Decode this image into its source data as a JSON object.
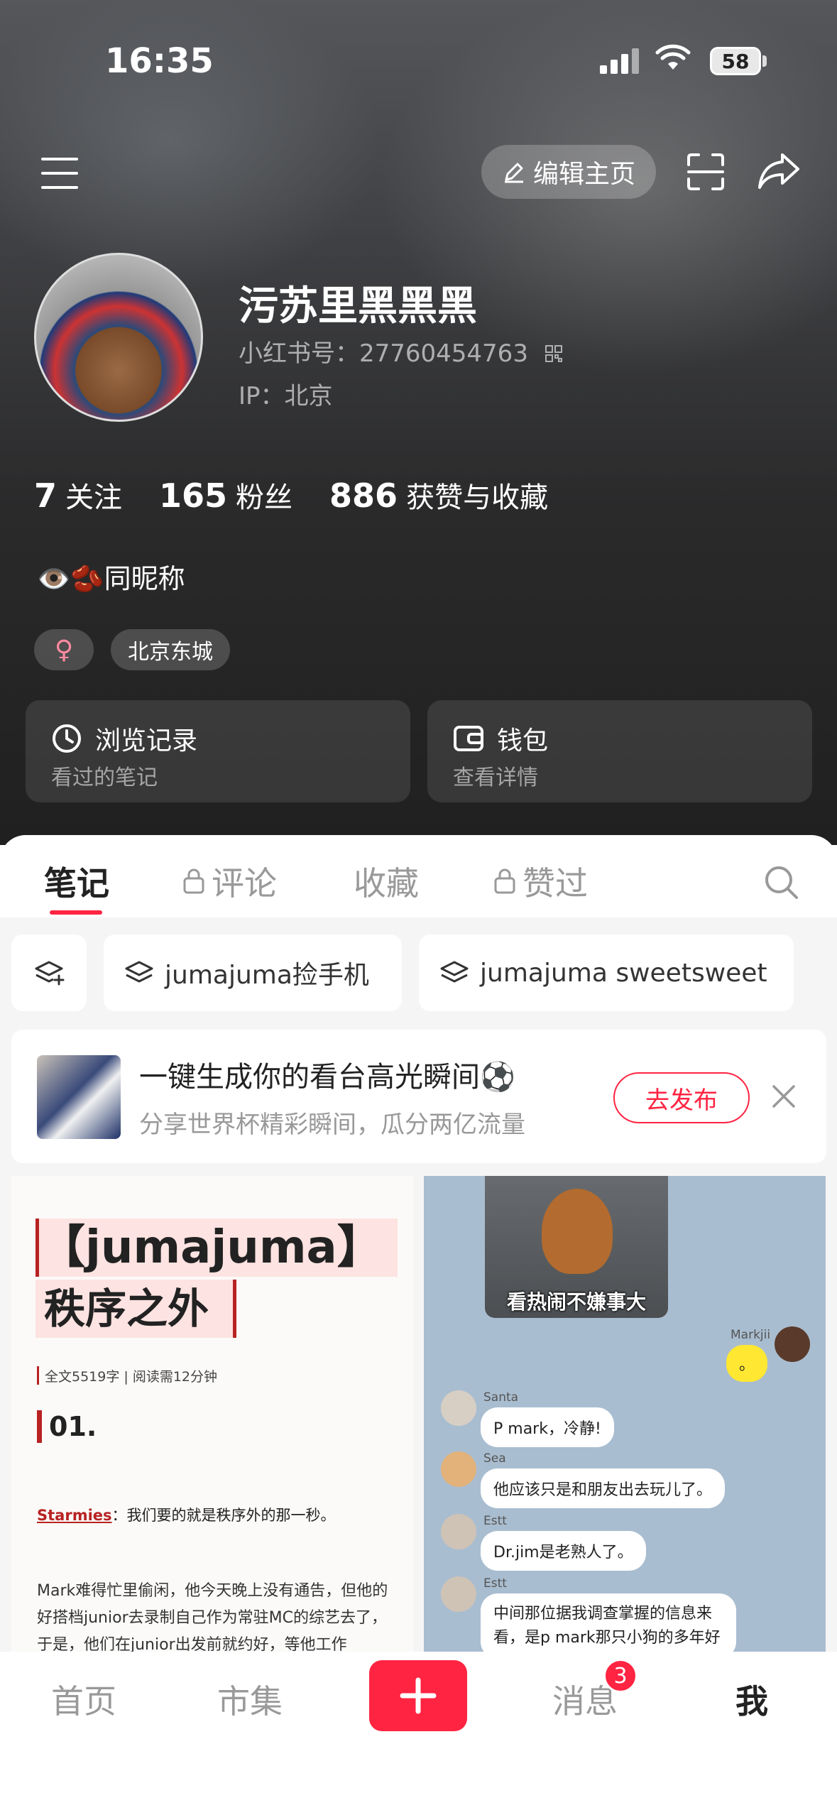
{
  "status_bar": {
    "time": "16:35",
    "battery": "58"
  },
  "header": {
    "edit_label": "编辑主页"
  },
  "profile": {
    "nickname": "污苏里黑黑黑",
    "xhs_id": "小红书号：27760454763",
    "ip": "IP：北京",
    "stats": [
      {
        "value": "7",
        "label": "关注"
      },
      {
        "value": "165",
        "label": "粉丝"
      },
      {
        "value": "886",
        "label": "获赞与收藏"
      }
    ],
    "bio": "👁️🫘同昵称",
    "gender_symbol": "♀",
    "location_tag": "北京东城"
  },
  "cards": [
    {
      "title": "浏览记录",
      "subtitle": "看过的笔记"
    },
    {
      "title": "钱包",
      "subtitle": "查看详情"
    }
  ],
  "tabs": [
    "笔记",
    "评论",
    "收藏",
    "赞过"
  ],
  "collections": [
    "jumajuma捡手机",
    "jumajuma sweetsweet"
  ],
  "promo": {
    "title": "一键生成你的看台高光瞬间⚽",
    "subtitle": "分享世界杯精彩瞬间，瓜分两亿流量",
    "button": "去发布"
  },
  "note_left": {
    "title_line1": "【jumajuma】",
    "title_line2": "秩序之外",
    "meta": "全文5519字 | 阅读需12分钟",
    "section": "01.",
    "quote_author": "Starmies",
    "quote_text": "：我们要的就是秩序外的那一秒。",
    "body": "Mark难得忙里偷闲，他今天晚上没有通告，但他的好搭档junior去录制自己作为常驻MC的综艺去了，于是，他们在junior出发前就约好，等他工作"
  },
  "note_right": {
    "meme_caption": "看热闹不嫌事大",
    "messages": [
      {
        "name": "Markjii",
        "text": "。"
      },
      {
        "name": "Santa",
        "text": "P mark，冷静!"
      },
      {
        "name": "Sea",
        "text": "他应该只是和朋友出去玩儿了。"
      },
      {
        "name": "Estt",
        "text": "Dr.jim是老熟人了。"
      },
      {
        "name": "Estt",
        "text": "中间那位据我调查掌握的信息来看，是p mark那只小狗的多年好"
      }
    ]
  },
  "bottom_nav": {
    "items": [
      "首页",
      "市集",
      "消息",
      "我"
    ],
    "message_badge": "3"
  },
  "colors": {
    "accent": "#ff2442",
    "hero_bg": "#2a2a2b"
  }
}
